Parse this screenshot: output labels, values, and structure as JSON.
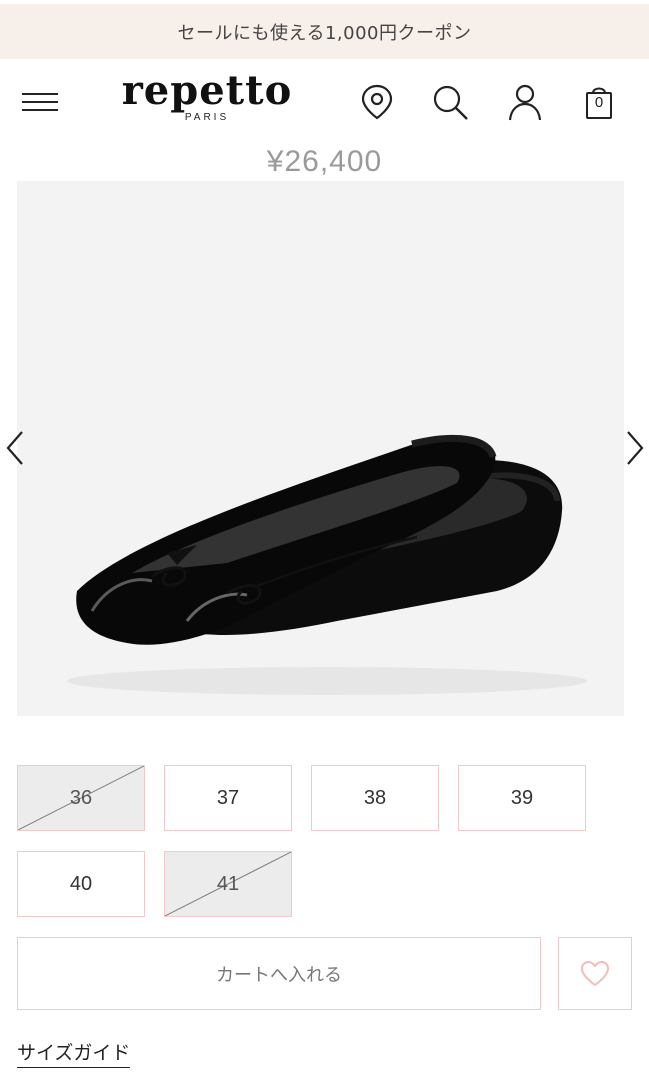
{
  "promo": {
    "text": "セールにも使える1,000円クーポン"
  },
  "header": {
    "logo_text": "repetto",
    "logo_sub": "PARIS",
    "icons": [
      "menu-icon",
      "location-pin-icon",
      "search-icon",
      "account-icon",
      "shopping-bag-icon"
    ],
    "cart_count": "0"
  },
  "product": {
    "price": "¥26,400",
    "sizes": [
      {
        "label": "36",
        "available": false
      },
      {
        "label": "37",
        "available": true
      },
      {
        "label": "38",
        "available": true
      },
      {
        "label": "39",
        "available": true
      },
      {
        "label": "40",
        "available": true
      },
      {
        "label": "41",
        "available": false
      }
    ]
  },
  "actions": {
    "add_to_cart": "カートへ入れる",
    "size_guide": "サイズガイド"
  },
  "colors": {
    "accent_border": "#f2c9c9",
    "promo_bg": "#f7efea",
    "heart": "#f3bcbc"
  }
}
